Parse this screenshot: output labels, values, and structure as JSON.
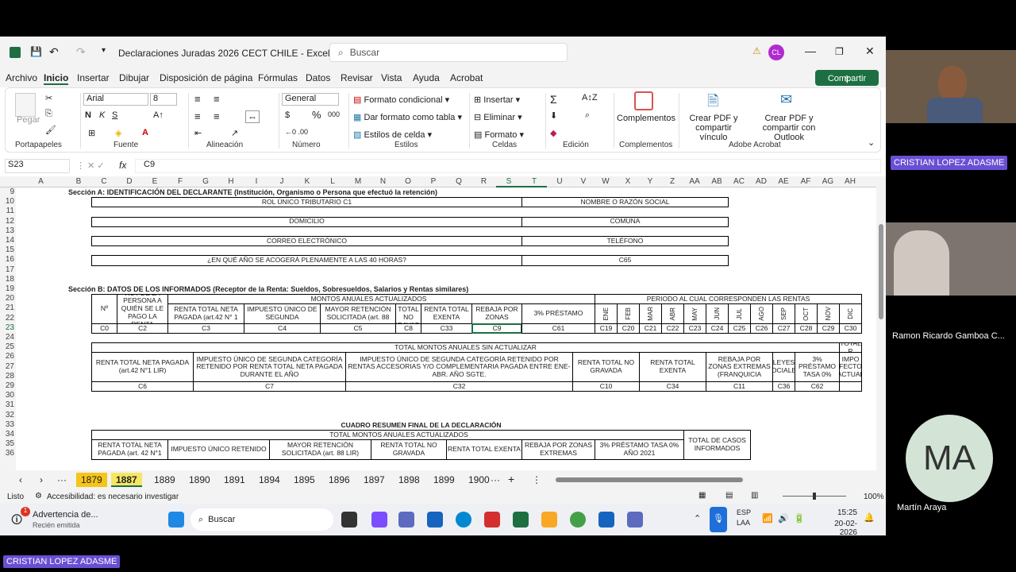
{
  "app": {
    "title": "Declaraciones Juradas 2026 CECT CHILE  -  Excel",
    "search": "Buscar",
    "user_initials": "CL",
    "share": "Compartir"
  },
  "menu": [
    "Archivo",
    "Inicio",
    "Insertar",
    "Dibujar",
    "Disposición de página",
    "Fórmulas",
    "Datos",
    "Revisar",
    "Vista",
    "Ayuda",
    "Acrobat"
  ],
  "ribbon": {
    "paste": "Pegar",
    "font_name": "Arial",
    "font_size": "8",
    "format": "General",
    "cond": "Formato condicional",
    "table": "Dar formato como tabla",
    "styles": "Estilos de celda",
    "insert": "Insertar",
    "delete": "Eliminar",
    "fmt": "Formato",
    "complementos": "Complementos",
    "pdf1": "Crear PDF y compartir vínculo",
    "pdf2": "Crear PDF y compartir con Outlook",
    "groups": [
      "Portapapeles",
      "Fuente",
      "Alineación",
      "Número",
      "Estilos",
      "Celdas",
      "Edición",
      "Complementos",
      "Adobe Acrobat"
    ]
  },
  "formula": {
    "cellref": "S23",
    "fx": "fx",
    "value": "C9"
  },
  "cols": [
    "A",
    "B",
    "C",
    "D",
    "E",
    "F",
    "G",
    "H",
    "I",
    "J",
    "K",
    "L",
    "M",
    "N",
    "O",
    "P",
    "Q",
    "R",
    "S",
    "T",
    "U",
    "V",
    "W",
    "X",
    "Y",
    "Z",
    "AA",
    "AB",
    "AC",
    "AD",
    "AE",
    "AF",
    "AG",
    "AH"
  ],
  "rows": [
    "9",
    "10",
    "11",
    "12",
    "13",
    "14",
    "15",
    "16",
    "17",
    "18",
    "19",
    "20",
    "21",
    "22",
    "23",
    "24",
    "25",
    "26",
    "27",
    "28",
    "29",
    "30",
    "31",
    "32",
    "33",
    "34",
    "35",
    "36"
  ],
  "sheet": {
    "secA": "Sección A: IDENTIFICACIÓN DEL DECLARANTE (Institución, Organismo o Persona que efectuó la retención)",
    "rol": "ROL ÚNICO TRIBUTARIO C1",
    "nombre": "NOMBRE O RAZÓN SOCIAL",
    "domicilio": "DOMICILIO",
    "comuna": "COMUNA",
    "correo": "CORREO ELECTRÓNICO",
    "telefono": "TELÉFONO",
    "anio": "¿EN QUÉ AÑO SE ACOGERÁ PLENAMENTE A LAS 40 HORAS?",
    "c65": "C65",
    "secB": "Sección B: DATOS DE LOS INFORMADOS (Receptor de la Renta: Sueldos, Sobresueldos, Salarios y Rentas similares)",
    "montos": "MONTOS ANUALES ACTUALIZADOS",
    "periodo": "PERIODO AL CUAL CORRESPONDEN LAS RENTAS",
    "bhead": [
      "Nº",
      "RUT DE LA PERSONA A QUIÉN SE LE PAGO LA RENTA",
      "RENTA TOTAL NETA PAGADA (art.42 N° 1",
      "IMPUESTO ÚNICO DE SEGUNDA",
      "MAYOR RETENCIÓN SOLICITADA (art. 88",
      "RENTA TOTAL NO GRAVADA",
      "RENTA TOTAL EXENTA",
      "REBAJA POR ZONAS",
      "3% PRÉSTAMO"
    ],
    "bvals": [
      "C0",
      "C2",
      "C3",
      "C4",
      "C5",
      "C8",
      "C33",
      "C9",
      "C61"
    ],
    "months": [
      "ENE",
      "FEB",
      "MAR",
      "ABR",
      "MAY",
      "JUN",
      "JUL",
      "AGO",
      "SEP",
      "OCT",
      "NOV",
      "DIC"
    ],
    "mvals": [
      "C19",
      "C20",
      "C21",
      "C22",
      "C23",
      "C24",
      "C25",
      "C26",
      "C27",
      "C28",
      "C29",
      "C30"
    ],
    "sin": "TOTAL MONTOS ANUALES SIN ACTUALIZAR",
    "totr": "TOTAL R",
    "shead": [
      "RENTA TOTAL NETA PAGADA (art.42 N°1 LIR)",
      "IMPUESTO ÚNICO DE SEGUNDA CATEGORÍA RETENIDO POR RENTA TOTAL NETA PAGADA DURANTE EL AÑO",
      "IMPUESTO ÚNICO DE SEGUNDA CATEGORÍA RETENIDO POR RENTAS ACCESORIAS Y/O COMPLEMENTARIA PAGADA ENTRE ENE-ABR. AÑO SGTE.",
      "RENTA TOTAL NO GRAVADA",
      "RENTA TOTAL EXENTA",
      "REBAJA POR ZONAS EXTREMAS (FRANQUICIA",
      "LEYES SOCIALES",
      "3% PRÉSTAMO TASA 0%",
      "IMPO EFECTOS ACTUAL"
    ],
    "svals": [
      "C6",
      "C7",
      "C32",
      "C10",
      "C34",
      "C11",
      "C36",
      "C62",
      ""
    ],
    "cuadro": "CUADRO RESUMEN FINAL DE LA DECLARACIÓN",
    "cuadro_sub": "TOTAL MONTOS ANUALES ACTUALIZADOS",
    "rhead": [
      "RENTA TOTAL NETA PAGADA (art. 42 N°1",
      "IMPUESTO ÚNICO RETENIDO",
      "MAYOR RETENCIÓN SOLICITADA (art. 88 LIR)",
      "RENTA TOTAL NO GRAVADA",
      "RENTA TOTAL EXENTA",
      "REBAJA POR ZONAS EXTREMAS",
      "3% PRÉSTAMO TASA 0% AÑO 2021",
      "TOTAL DE CASOS INFORMADOS"
    ]
  },
  "tabs": [
    "1879",
    "1887",
    "1889",
    "1890",
    "1891",
    "1894",
    "1895",
    "1896",
    "1897",
    "1898",
    "1899",
    "1900"
  ],
  "status": {
    "ready": "Listo",
    "accessibility": "Accesibilidad: es necesario investigar",
    "zoom": "100%"
  },
  "taskbar": {
    "notif_title": "Advertencia de...",
    "notif_sub": "Recién emitida",
    "search": "Buscar",
    "lang1": "ESP",
    "lang2": "LAA",
    "time": "15:25",
    "date": "20-02-2026",
    "badge": "1"
  },
  "participants": {
    "p1": "CRISTIAN LOPEZ ADASME",
    "p2": "Ramon Ricardo Gamboa C...",
    "p3": "Martín Araya",
    "p3_initials": "MA",
    "bottom": "CRISTIAN LOPEZ ADASME"
  }
}
